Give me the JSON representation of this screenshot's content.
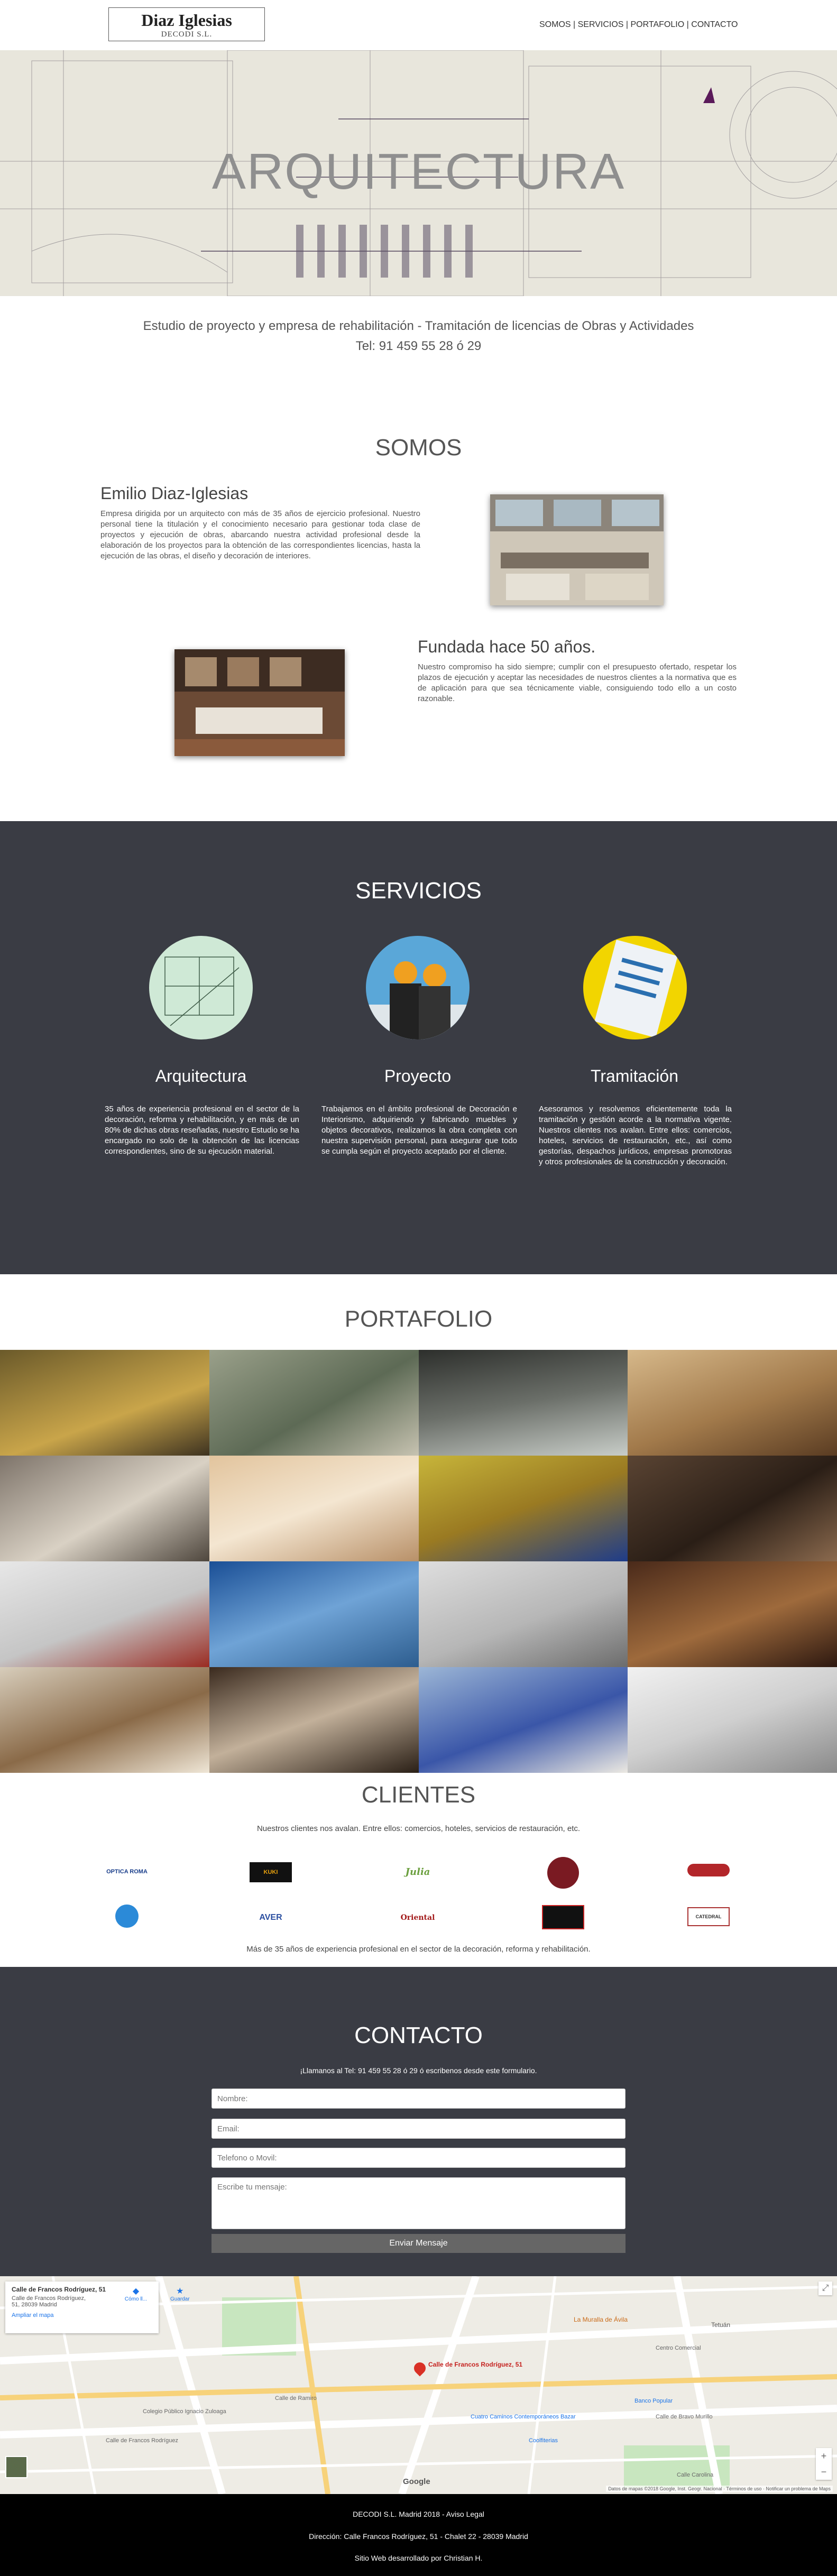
{
  "nav": {
    "logo_name": "Diaz Iglesias",
    "logo_sub": "DECODI S.L.",
    "menu": [
      "SOMOS",
      "SERVICIOS",
      "PORTAFOLIO",
      "CONTACTO"
    ],
    "separator": " | "
  },
  "hero": {
    "title": "ARQUITECTURA"
  },
  "intro": {
    "line1": "Estudio de proyecto y empresa de rehabilitación - Tramitación de licencias de Obras y Actividades",
    "line2": "Tel: 91 459 55 28 ó 29"
  },
  "somos": {
    "title": "SOMOS",
    "block1_title": "Emilio Diaz-Iglesias",
    "block1_text": "Empresa dirigida por un arquitecto con más de 35 años de ejercicio profesional. Nuestro personal tiene la titulación y el conocimiento necesario para gestionar toda clase de proyectos y ejecución de obras, abarcando nuestra actividad profesional desde la elaboración de los proyectos para la obtención de las correspondientes licencias, hasta la ejecución de las obras, el diseño y decoración de interiores.",
    "block2_title": "Fundada hace 50 años.",
    "block2_text": "Nuestro compromiso ha sido siempre; cumplir con el presupuesto ofertado, respetar los plazos de ejecución y aceptar las necesidades de nuestros clientes a la normativa que es de aplicación para que sea técnicamente viable, consiguiendo todo ello a un costo razonable."
  },
  "servicios": {
    "title": "SERVICIOS",
    "items": [
      {
        "title": "Arquitectura",
        "text": "35 años de experiencia profesional en el sector de la decoración, reforma y rehabilitación, y en más de un 80% de dichas obras reseñadas, nuestro Estudio se ha encargado no solo de la obtención de las licencias correspondientes, sino de su ejecución material."
      },
      {
        "title": "Proyecto",
        "text": "Trabajamos en el ámbito profesional de Decoración e Interiorismo, adquiriendo y fabricando muebles y objetos decorativos, realizamos la obra completa con nuestra supervisión personal, para asegurar que todo se cumpla según el proyecto aceptado por el cliente."
      },
      {
        "title": "Tramitación",
        "text": "Asesoramos y resolvemos eficientemente toda la tramitación y gestión acorde a la normativa vigente. Nuestros clientes nos avalan. Entre ellos: comercios, hoteles, servicios de restauración, etc., así como gestorías, despachos jurídicos, empresas promotoras y otros profesionales de la construcción y decoración."
      }
    ]
  },
  "portafolio": {
    "title": "PORTAFOLIO"
  },
  "clientes": {
    "title": "CLIENTES",
    "intro": "Nuestros clientes nos avalan. Entre ellos: comercios, hoteles, servicios de restauración, etc.",
    "logos": [
      "OPTICA ROMA",
      "KUKI",
      "Julia",
      "",
      "",
      "",
      "AVER",
      "Oriental",
      "",
      "CATEDRAL"
    ],
    "footer": "Más de 35 años de experiencia profesional en el sector de la decoración, reforma y rehabilitación."
  },
  "contacto": {
    "title": "CONTACTO",
    "intro": "¡Llamanos al Tel: 91 459 55 28 ó 29 ó escribenos desde este formulario.",
    "name_placeholder": "Nombre:",
    "email_placeholder": "Email:",
    "phone_placeholder": "Telefono o Movil:",
    "message_placeholder": "Escribe tu mensaje:",
    "send_label": "Enviar Mensaje"
  },
  "map": {
    "place_title": "Calle de Francos Rodríguez, 51",
    "place_address": "Calle de Francos Rodríguez, 51, 28039 Madrid",
    "enlarge_link": "Ampliar el mapa",
    "directions": "Cómo ll...",
    "save": "Guardar",
    "pin_label": "Calle de Francos Rodríguez, 51",
    "labels": [
      "Calle de Francos Rodríguez",
      "Colegio Público Ignacio Zuloaga",
      "Calle de Ramiro",
      "La Muralla de Ávila",
      "Tetuán",
      "Coolfiterias",
      "Banco Popular",
      "Cuatro Caminos Contemporáneos Bazar",
      "Centro Comercial",
      "Calle de Bravo Murillo",
      "Calle Carolina"
    ],
    "attribution": "Datos de mapas ©2018 Google, Inst. Geogr. Nacional · Términos de uso · Notificar un problema de Maps",
    "google": "Google"
  },
  "footer": {
    "line1": "DECODI S.L. Madrid 2018 - Aviso Legal",
    "line2": "Dirección: Calle Francos Rodríguez, 51 - Chalet 22 - 28039 Madrid",
    "line3": "Sitio Web desarrollado por Christian H."
  }
}
